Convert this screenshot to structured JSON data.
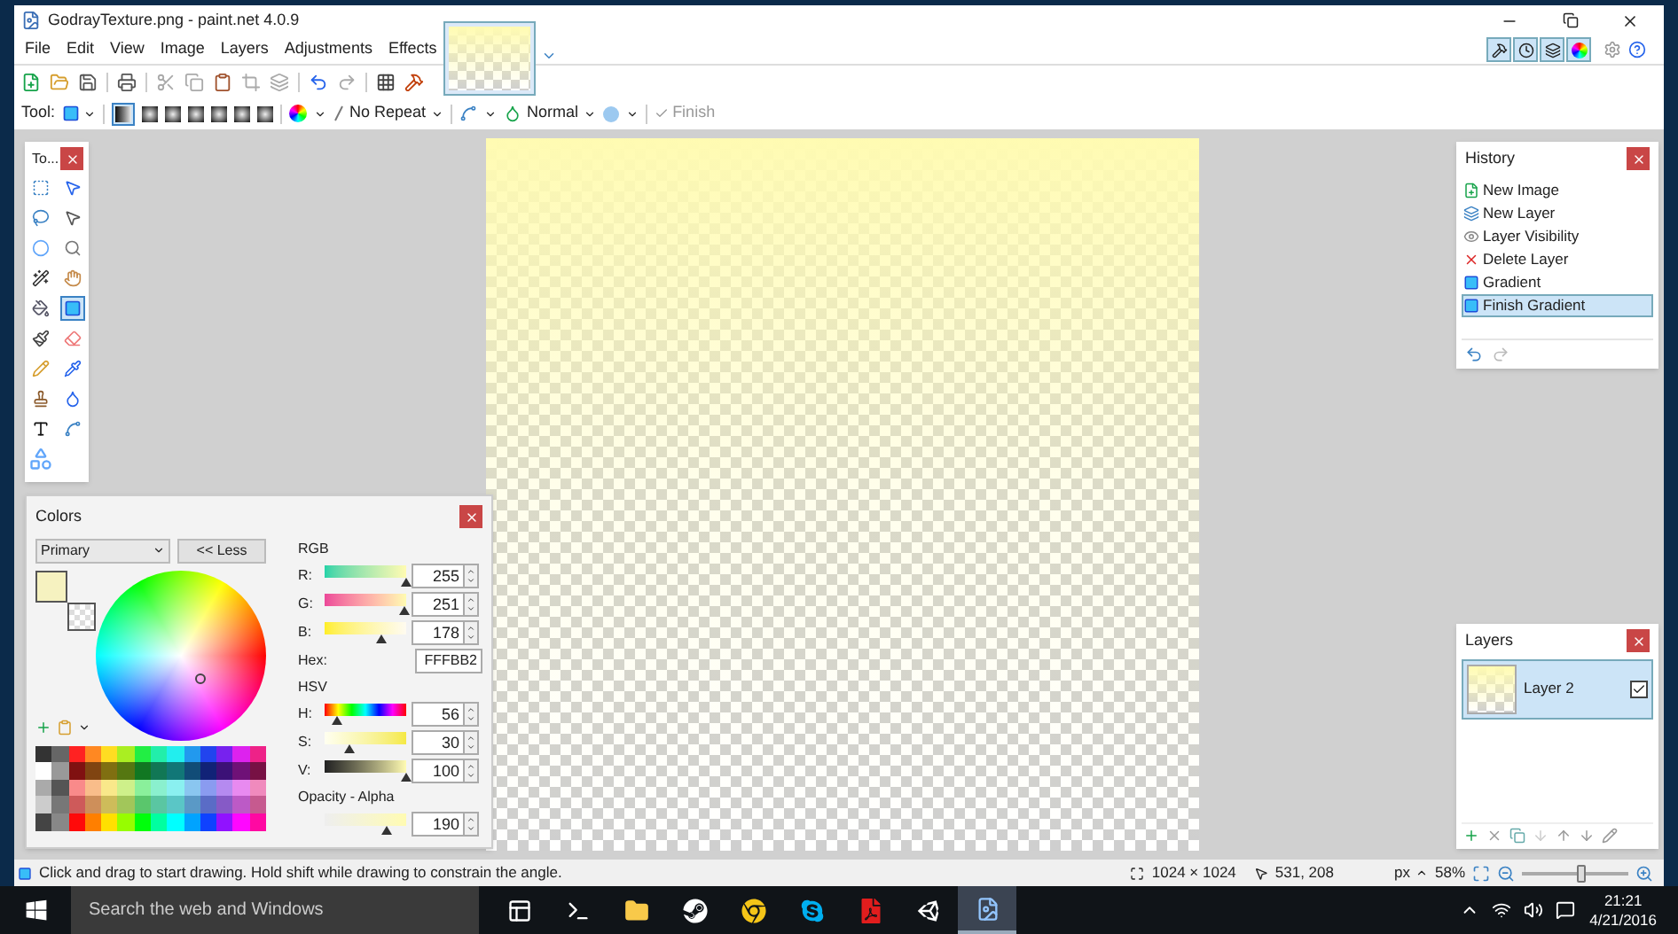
{
  "window": {
    "title": "GodrayTexture.png - paint.net 4.0.9"
  },
  "menu": [
    "File",
    "Edit",
    "View",
    "Image",
    "Layers",
    "Adjustments",
    "Effects"
  ],
  "tool_options": {
    "tool_label": "Tool:",
    "repeat": "No Repeat",
    "blend": "Normal",
    "finish": "Finish",
    "finish_disabled": true
  },
  "tools_panel": {
    "title": "To...",
    "tools": [
      {
        "kind": "rect-select",
        "selected": false
      },
      {
        "kind": "move-selected",
        "selected": false
      },
      {
        "kind": "lasso",
        "selected": false
      },
      {
        "kind": "move-selection",
        "selected": false
      },
      {
        "kind": "ellipse-select",
        "selected": false
      },
      {
        "kind": "zoom",
        "selected": false
      },
      {
        "kind": "magic-wand",
        "selected": false
      },
      {
        "kind": "pan",
        "selected": false
      },
      {
        "kind": "bucket",
        "selected": false
      },
      {
        "kind": "gradient",
        "selected": true
      },
      {
        "kind": "brush",
        "selected": false
      },
      {
        "kind": "eraser",
        "selected": false
      },
      {
        "kind": "pencil",
        "selected": false
      },
      {
        "kind": "picker",
        "selected": false
      },
      {
        "kind": "stamp",
        "selected": false
      },
      {
        "kind": "recolor",
        "selected": false
      },
      {
        "kind": "text",
        "selected": false
      },
      {
        "kind": "line",
        "selected": false
      },
      {
        "kind": "shapes",
        "selected": false
      }
    ]
  },
  "colors_panel": {
    "title": "Colors",
    "mode": "Primary",
    "less_button": "<< Less",
    "rgb_heading": "RGB",
    "rgb": [
      {
        "label": "R:",
        "value": "255",
        "level": 1
      },
      {
        "label": "G:",
        "value": "251",
        "level": 0.98
      },
      {
        "label": "B:",
        "value": "178",
        "level": 0.7
      }
    ],
    "hex_label": "Hex:",
    "hex": "FFFBB2",
    "hsv_heading": "HSV",
    "hsv": [
      {
        "label": "H:",
        "value": "56",
        "level": 0.16
      },
      {
        "label": "S:",
        "value": "30",
        "level": 0.3
      },
      {
        "label": "V:",
        "value": "100",
        "level": 1
      }
    ],
    "alpha_heading": "Opacity - Alpha",
    "alpha": {
      "value": "190",
      "level": 0.75
    }
  },
  "history_panel": {
    "title": "History",
    "items": [
      {
        "kind": "new-image",
        "label": "New Image",
        "selected": false
      },
      {
        "kind": "new-layer",
        "label": "New Layer",
        "selected": false
      },
      {
        "kind": "visibility",
        "label": "Layer Visibility",
        "selected": false
      },
      {
        "kind": "delete",
        "label": "Delete Layer",
        "selected": false
      },
      {
        "kind": "gradient",
        "label": "Gradient",
        "selected": false
      },
      {
        "kind": "gradient",
        "label": "Finish Gradient",
        "selected": true
      }
    ]
  },
  "layers_panel": {
    "title": "Layers",
    "layers": [
      {
        "name": "Layer 2",
        "visible": true,
        "selected": true
      }
    ]
  },
  "status_bar": {
    "hint": "Click and drag to start drawing. Hold shift while drawing to constrain the angle.",
    "size": "1024 × 1024",
    "cursor": "531, 208",
    "unit": "px",
    "zoom": "58%",
    "zoom_level": {
      "level": 0.55
    }
  },
  "taskbar": {
    "search_placeholder": "Search the web and Windows",
    "apps": [
      {
        "kind": "task-view",
        "active": false
      },
      {
        "kind": "terminal",
        "active": false
      },
      {
        "kind": "folder",
        "active": false
      },
      {
        "kind": "steam",
        "active": false
      },
      {
        "kind": "chrome",
        "active": false
      },
      {
        "kind": "skype",
        "active": false
      },
      {
        "kind": "pdf",
        "active": false
      },
      {
        "kind": "unity",
        "active": false
      },
      {
        "kind": "paint",
        "active": true
      }
    ],
    "time": "21:21",
    "date": "4/21/2016"
  }
}
